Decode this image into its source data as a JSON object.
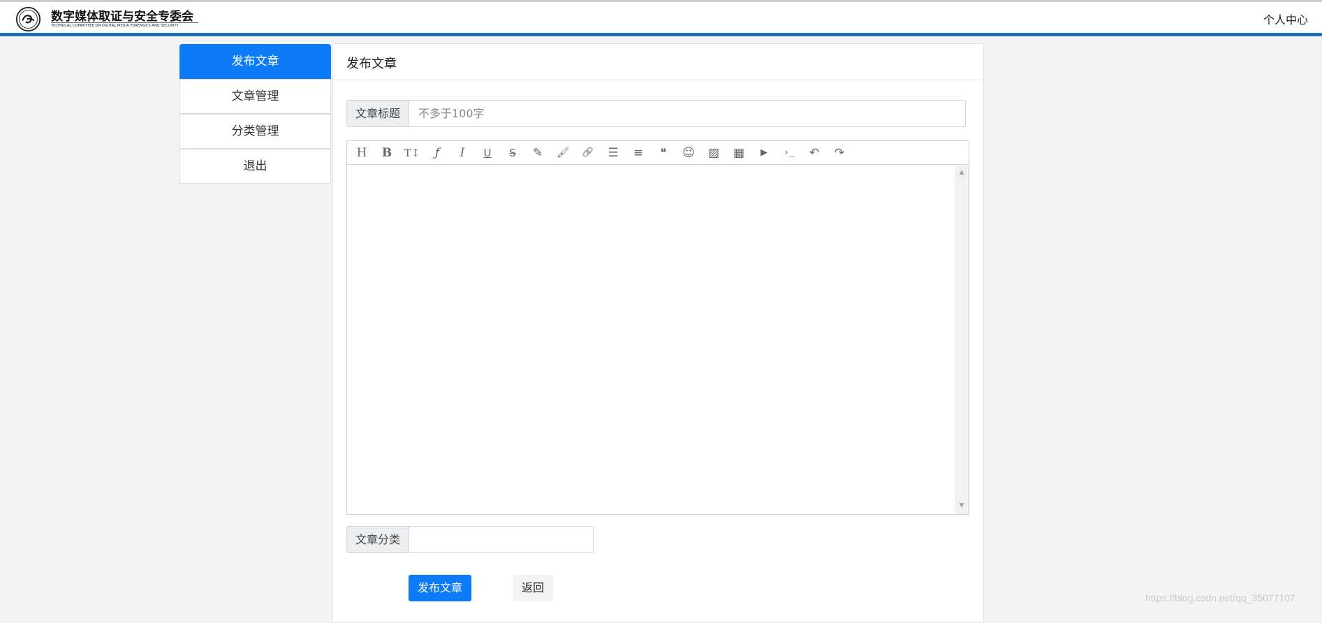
{
  "header": {
    "org_name": "数字媒体取证与安全专委会",
    "org_subtitle": "TECHNICAL COMMITTEE ON DIGITAL MEDIA FORENSICS AND SECURITY",
    "user_center": "个人中心"
  },
  "sidebar": {
    "items": [
      {
        "label": "发布文章",
        "active": true
      },
      {
        "label": "文章管理",
        "active": false
      },
      {
        "label": "分类管理",
        "active": false
      },
      {
        "label": "退出",
        "active": false
      }
    ]
  },
  "main": {
    "title": "发布文章",
    "title_field": {
      "label": "文章标题",
      "value": "",
      "placeholder": "不多于100字"
    },
    "editor": {
      "toolbar": [
        {
          "icon": "heading-icon",
          "glyph": "H"
        },
        {
          "icon": "bold-icon",
          "glyph": "B"
        },
        {
          "icon": "font-size-icon",
          "glyph": "T↕"
        },
        {
          "icon": "font-family-icon",
          "glyph": "ƒ"
        },
        {
          "icon": "italic-icon",
          "glyph": "I"
        },
        {
          "icon": "underline-icon",
          "glyph": "U"
        },
        {
          "icon": "strikethrough-icon",
          "glyph": "S"
        },
        {
          "icon": "highlighter-icon",
          "glyph": "✎"
        },
        {
          "icon": "brush-icon",
          "glyph": "🖌"
        },
        {
          "icon": "link-icon",
          "glyph": "🔗"
        },
        {
          "icon": "list-icon",
          "glyph": "☰"
        },
        {
          "icon": "align-icon",
          "glyph": "≡"
        },
        {
          "icon": "quote-icon",
          "glyph": "❝"
        },
        {
          "icon": "emoji-icon",
          "glyph": "☺"
        },
        {
          "icon": "image-icon",
          "glyph": "▨"
        },
        {
          "icon": "table-icon",
          "glyph": "▦"
        },
        {
          "icon": "video-icon",
          "glyph": "▶"
        },
        {
          "icon": "code-icon",
          "glyph": "›_"
        },
        {
          "icon": "undo-icon",
          "glyph": "↶"
        },
        {
          "icon": "redo-icon",
          "glyph": "↷"
        }
      ],
      "content": ""
    },
    "category_field": {
      "label": "文章分类",
      "value": ""
    },
    "publish_button": "发布文章",
    "back_button": "返回"
  },
  "watermark": "https://blog.csdn.net/qq_35077107",
  "colors": {
    "accent": "#0d7bf7",
    "header_bar": "#1f6fb5",
    "background": "#f4f4f4"
  }
}
